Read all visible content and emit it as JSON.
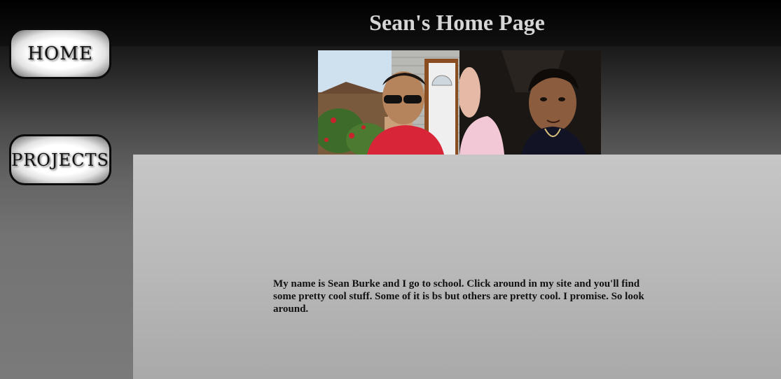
{
  "header": {
    "title": "Sean's Home Page"
  },
  "nav": {
    "items": [
      {
        "label": "HOME"
      },
      {
        "label": "PROJECTS"
      }
    ]
  },
  "main": {
    "intro": "My name is Sean Burke and I go to school. Click around in my site and you'll find some pretty cool stuff. Some of it is bs but others are pretty cool. I promise. So look around."
  },
  "colors": {
    "title_text": "#d6d6d6",
    "panel_top": "#c6c6c6",
    "panel_bottom": "#a9a9a9",
    "button_border": "#0c0c0c"
  }
}
